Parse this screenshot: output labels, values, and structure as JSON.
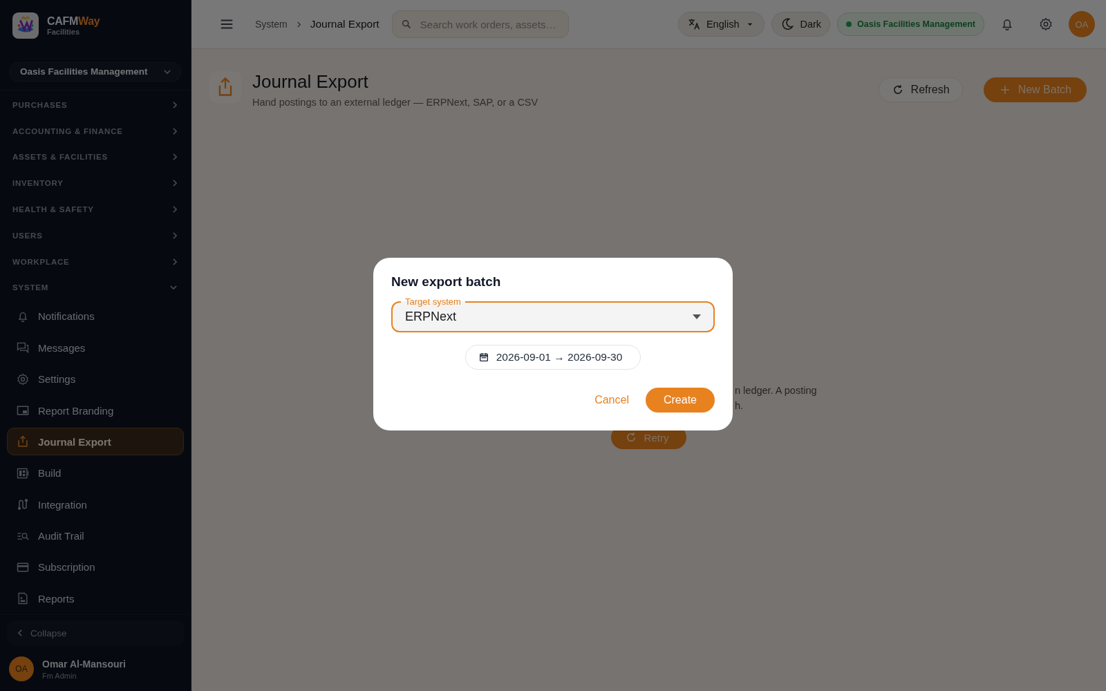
{
  "brand": {
    "name": "CAFM",
    "name_accent": "Way",
    "subtitle": "Facilities"
  },
  "org_switcher": {
    "value": "Oasis Facilities Management"
  },
  "sidebar": {
    "sections": [
      {
        "label": "PURCHASES",
        "expanded": false
      },
      {
        "label": "ACCOUNTING & FINANCE",
        "expanded": false
      },
      {
        "label": "ASSETS & FACILITIES",
        "expanded": false
      },
      {
        "label": "INVENTORY",
        "expanded": false
      },
      {
        "label": "HEALTH & SAFETY",
        "expanded": false
      },
      {
        "label": "USERS",
        "expanded": false
      },
      {
        "label": "WORKPLACE",
        "expanded": false
      },
      {
        "label": "SYSTEM",
        "expanded": true,
        "items": [
          {
            "label": "Notifications",
            "selected": false
          },
          {
            "label": "Messages",
            "selected": false
          },
          {
            "label": "Settings",
            "selected": false
          },
          {
            "label": "Report Branding",
            "selected": false
          },
          {
            "label": "Journal Export",
            "selected": true
          },
          {
            "label": "Build",
            "selected": false
          },
          {
            "label": "Integration",
            "selected": false
          },
          {
            "label": "Audit Trail",
            "selected": false
          },
          {
            "label": "Subscription",
            "selected": false
          },
          {
            "label": "Reports",
            "selected": false
          }
        ]
      }
    ]
  },
  "collapse": "Collapse",
  "user": {
    "initials": "OA",
    "name": "Omar Al-Mansouri",
    "role": "Fm Admin"
  },
  "topbar": {
    "breadcrumb": [
      "System",
      "Journal Export"
    ],
    "search": {
      "placeholder": "Search work orders, assets…"
    },
    "language": "English",
    "theme": "Dark",
    "org_status": "Oasis Facilities Management",
    "avatar": "OA"
  },
  "page": {
    "title": "Journal Export",
    "subtitle": "Hand postings to an external ledger — ERPNext, SAP, or a CSV",
    "actions": [
      {
        "label": "Refresh",
        "kind": "outline"
      },
      {
        "label": "New Batch",
        "kind": "primary"
      }
    ]
  },
  "empty_state": {
    "text_lines": [
      "n ledger. A posting",
      "h."
    ],
    "retry": "Retry"
  },
  "dialog": {
    "title": "New export batch",
    "target_field": {
      "label": "Target system",
      "value": "ERPNext"
    },
    "date_range": "2026-09-01 → 2026-09-30",
    "buttons": [
      {
        "label": "Cancel",
        "kind": "text"
      },
      {
        "label": "Create",
        "kind": "primary"
      }
    ]
  }
}
